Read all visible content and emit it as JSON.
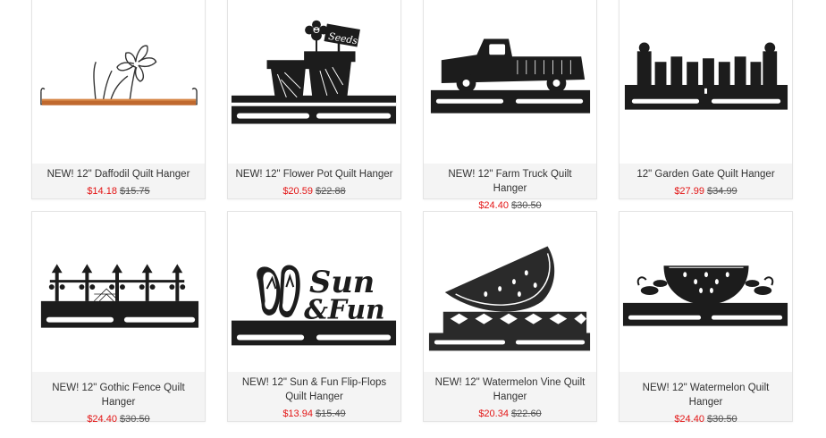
{
  "products": [
    {
      "name": "NEW! 12\" Daffodil Quilt Hanger",
      "sale_price": "$14.18",
      "original_price": "$15.75",
      "image": "daffodil-hanger-icon"
    },
    {
      "name": "NEW! 12\" Flower Pot Quilt Hanger",
      "sale_price": "$20.59",
      "original_price": "$22.88",
      "image": "flower-pot-hanger-icon",
      "image_text": "Seeds"
    },
    {
      "name": "NEW! 12\" Farm Truck Quilt Hanger",
      "sale_price": "$24.40",
      "original_price": "$30.50",
      "image": "farm-truck-hanger-icon"
    },
    {
      "name": "12\" Garden Gate Quilt Hanger",
      "sale_price": "$27.99",
      "original_price": "$34.99",
      "image": "garden-gate-hanger-icon"
    },
    {
      "name": "NEW! 12\" Gothic Fence Quilt Hanger",
      "sale_price": "$24.40",
      "original_price": "$30.50",
      "image": "gothic-fence-hanger-icon"
    },
    {
      "name": "NEW! 12\" Sun & Fun Flip-Flops Quilt Hanger",
      "sale_price": "$13.94",
      "original_price": "$15.49",
      "image": "flip-flops-hanger-icon",
      "image_text_1": "Sun",
      "image_text_2": "&Fun"
    },
    {
      "name": "NEW! 12\" Watermelon Vine Quilt Hanger",
      "sale_price": "$20.34",
      "original_price": "$22.60",
      "image": "watermelon-vine-hanger-icon"
    },
    {
      "name": "NEW! 12\" Watermelon Quilt Hanger",
      "sale_price": "$24.40",
      "original_price": "$30.50",
      "image": "watermelon-hanger-icon"
    }
  ],
  "colors": {
    "sale": "#e31515",
    "name": "#333333",
    "info_bg": "#f4f4f4",
    "metal": "#1c1c1c"
  }
}
